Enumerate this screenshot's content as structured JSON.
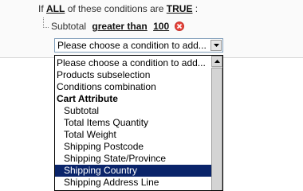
{
  "condition_header": {
    "prefix": "If",
    "aggregator": "ALL",
    "middle": "of these conditions are",
    "value": "TRUE",
    "suffix": ":"
  },
  "rule": {
    "attribute": "Subtotal",
    "operator": "greater than",
    "value": "100",
    "remove_icon": "remove-icon"
  },
  "select": {
    "value": "Please choose a condition to add..."
  },
  "dropdown": {
    "options": [
      "Please choose a condition to add...",
      "Products subselection",
      "Conditions combination"
    ],
    "group_label": "Cart Attribute",
    "group_options": [
      "Subtotal",
      "Total Items Quantity",
      "Total Weight",
      "Shipping Postcode",
      "Shipping State/Province",
      "Shipping Country",
      "Shipping Address Line"
    ],
    "selected_option": "Shipping Country"
  },
  "colors": {
    "selection": "#0a246a",
    "remove": "#e8443b",
    "select_border": "#7f9db9"
  }
}
